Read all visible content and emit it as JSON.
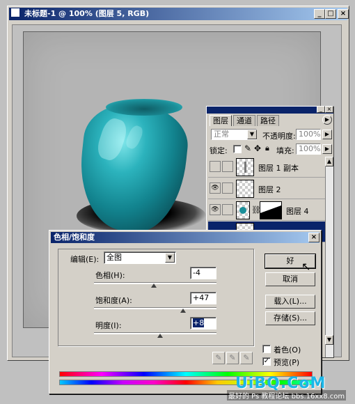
{
  "document": {
    "title": "未标题-1 @ 100% (图层 5, RGB)",
    "controls": {
      "minimize": "_",
      "maximize": "□",
      "close": "×"
    }
  },
  "layers_panel": {
    "tabs": [
      "图层",
      "通道",
      "路径"
    ],
    "blend_mode": "正常",
    "opacity_label": "不透明度:",
    "opacity_value": "100%",
    "lock_label": "锁定:",
    "fill_label": "填充:",
    "fill_value": "100%",
    "layers": [
      {
        "name": "图层 1 副本",
        "visible": false,
        "selected": false
      },
      {
        "name": "图层 2",
        "visible": true,
        "selected": false
      },
      {
        "name": "图层 4",
        "visible": true,
        "selected": false,
        "has_mask": true
      },
      {
        "name": "",
        "visible": true,
        "selected": true
      }
    ]
  },
  "dialog": {
    "title": "色相/饱和度",
    "edit_label": "编辑(E):",
    "edit_value": "全图",
    "hue": {
      "label": "色相(H):",
      "value": "-4",
      "slider_fraction": 0.49
    },
    "saturation": {
      "label": "饱和度(A):",
      "value": "+47",
      "slider_fraction": 0.73
    },
    "lightness": {
      "label": "明度(I):",
      "value": "+8",
      "slider_fraction": 0.54
    },
    "buttons": {
      "ok": "好",
      "cancel": "取消",
      "load": "载入(L)...",
      "save": "存储(S)..."
    },
    "colorize_label": "着色(O)",
    "colorize_checked": false,
    "preview_label": "预览(P)",
    "preview_checked": true
  },
  "watermark": {
    "text": "UiBQ.CoM",
    "subtext": "最好的 Ps 教程论坛 bbs.16xx8.com"
  },
  "colors": {
    "accent_titlebar": "#0a246a",
    "vase": "#1b9aa4",
    "watermark": "#1bb6e8"
  }
}
